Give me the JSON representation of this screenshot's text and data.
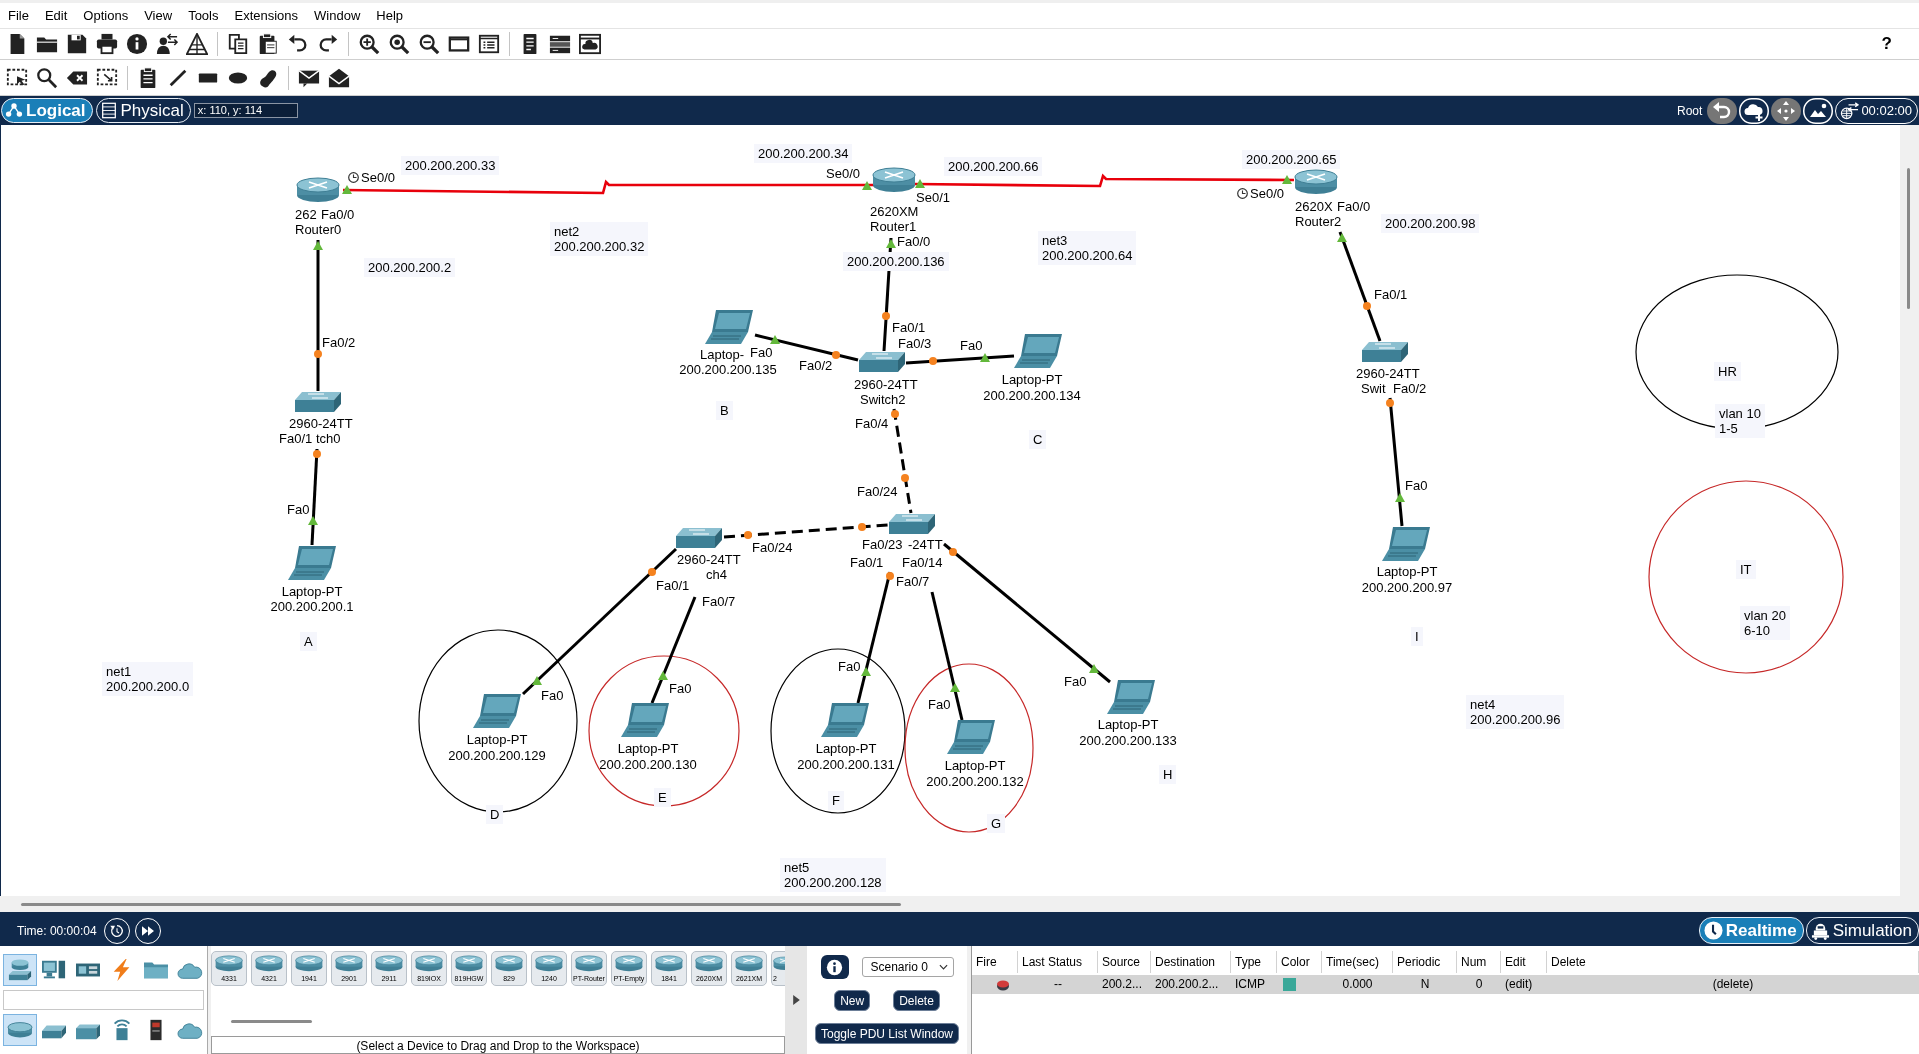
{
  "menu_bar": [
    "File",
    "Edit",
    "Options",
    "View",
    "Tools",
    "Extensions",
    "Window",
    "Help"
  ],
  "help_button": "?",
  "workspace_tabs": [
    {
      "label": "Logical",
      "selected": true
    },
    {
      "label": "Physical",
      "selected": false
    }
  ],
  "cursor_position": "x: 110, y: 114",
  "workspace_path": "Root",
  "clock": "00:02:00",
  "devices": [
    {
      "kind": "router",
      "model": "262",
      "name": "Router0"
    },
    {
      "kind": "router",
      "model": "2620XM",
      "name": "Router1"
    },
    {
      "kind": "router",
      "model": "2620X",
      "name": "Router2"
    },
    {
      "kind": "switch",
      "model": "2960-24TT",
      "name": "tch0"
    },
    {
      "kind": "switch",
      "model": "2960-24TT",
      "name": "Switch2"
    },
    {
      "kind": "switch",
      "model": "2960-24TT",
      "name": "Swit"
    },
    {
      "kind": "switch",
      "model": "2960-24TT",
      "name": "ch4"
    },
    {
      "kind": "switch",
      "model": "-24TT"
    },
    {
      "kind": "laptop",
      "model": "Laptop-PT",
      "name": "200.200.200.1"
    },
    {
      "kind": "laptop",
      "model": "Laptop-",
      "name": "200.200.200.135"
    },
    {
      "kind": "laptop",
      "model": "Laptop-PT",
      "name": "200.200.200.134"
    },
    {
      "kind": "laptop",
      "model": "Laptop-PT",
      "name": "200.200.200.129"
    },
    {
      "kind": "laptop",
      "model": "Laptop-PT",
      "name": "200.200.200.130"
    },
    {
      "kind": "laptop",
      "model": "Laptop-PT",
      "name": "200.200.200.131"
    },
    {
      "kind": "laptop",
      "model": "Laptop-PT",
      "name": "200.200.200.132"
    },
    {
      "kind": "laptop",
      "model": "Laptop-PT",
      "name": "200.200.200.133"
    },
    {
      "kind": "laptop",
      "model": "Laptop-PT",
      "name": "200.200.200.97"
    }
  ],
  "links": [
    {
      "kind": "serial",
      "ends": [
        {
          "port": "Se0/0",
          "forwarding": true,
          "clock": true
        },
        {
          "port": "Se0/0",
          "forwarding": true,
          "clock": false
        }
      ]
    },
    {
      "kind": "serial",
      "ends": [
        {
          "port": "Se0/1",
          "forwarding": true,
          "clock": false
        },
        {
          "port": "Se0/0",
          "forwarding": true,
          "clock": true
        }
      ]
    },
    {
      "kind": "straight",
      "ends": [
        {
          "port": "Fa0/0",
          "forwarding": true
        },
        {
          "port": "Fa0/2",
          "forwarding": false
        }
      ]
    },
    {
      "kind": "straight",
      "ends": [
        {
          "port": "Fa0/1",
          "forwarding": false
        },
        {
          "port": "Fa0",
          "forwarding": true
        }
      ]
    },
    {
      "kind": "straight",
      "ends": [
        {
          "port": "Fa0/0",
          "forwarding": true
        },
        {
          "port": "Fa0/1",
          "forwarding": false
        }
      ]
    },
    {
      "kind": "straight",
      "ends": [
        {
          "port": "Fa0",
          "forwarding": true
        },
        {
          "port": "Fa0/2",
          "forwarding": false
        }
      ]
    },
    {
      "kind": "straight",
      "ends": [
        {
          "port": "Fa0/3",
          "forwarding": false
        },
        {
          "port": "Fa0",
          "forwarding": true
        }
      ]
    },
    {
      "kind": "crossover",
      "ends": [
        {
          "port": "Fa0/4",
          "forwarding": false
        },
        {
          "port": "Fa0/24",
          "forwarding": false
        }
      ]
    },
    {
      "kind": "crossover",
      "ends": [
        {
          "port": "Fa0/24",
          "forwarding": false
        },
        {
          "port": "Fa0/23",
          "forwarding": false
        }
      ]
    },
    {
      "kind": "straight",
      "ends": [
        {
          "port": "Fa0/1",
          "forwarding": false
        },
        {
          "port": "Fa0",
          "forwarding": true
        }
      ]
    },
    {
      "kind": "straight",
      "ends": [
        {
          "port": "Fa0/7"
        },
        {
          "port": "Fa0",
          "forwarding": true
        }
      ]
    },
    {
      "kind": "straight",
      "ends": [
        {
          "port": "Fa0/1",
          "forwarding": false
        },
        {
          "port": "Fa0",
          "forwarding": true
        }
      ]
    },
    {
      "kind": "straight",
      "ends": [
        {
          "port": "Fa0/7"
        },
        {
          "port": "Fa0",
          "forwarding": true
        }
      ]
    },
    {
      "kind": "straight",
      "ends": [
        {
          "port": "Fa0/14",
          "forwarding": false
        },
        {
          "port": "Fa0",
          "forwarding": true
        }
      ]
    },
    {
      "kind": "straight",
      "ends": [
        {
          "port": "Fa0/0",
          "forwarding": true
        },
        {
          "port": "Fa0/1",
          "forwarding": false
        }
      ]
    },
    {
      "kind": "straight",
      "ends": [
        {
          "port": "Fa0/2",
          "forwarding": false
        },
        {
          "port": "Fa0",
          "forwarding": true
        }
      ]
    }
  ],
  "notes": [
    {
      "text": "200.200.200.33"
    },
    {
      "text": "200.200.200.34"
    },
    {
      "text": "200.200.200.66"
    },
    {
      "text": "200.200.200.65"
    },
    {
      "text": "net2\n200.200.200.32"
    },
    {
      "text": "200.200.200.2"
    },
    {
      "text": "200.200.200.136"
    },
    {
      "text": "net3\n200.200.200.64"
    },
    {
      "text": "200.200.200.98"
    },
    {
      "text": "HR"
    },
    {
      "text": "vlan 10\n1-5"
    },
    {
      "text": "B"
    },
    {
      "text": "C"
    },
    {
      "text": "A"
    },
    {
      "text": "net1\n200.200.200.0"
    },
    {
      "text": "IT"
    },
    {
      "text": "vlan 20\n6-10"
    },
    {
      "text": "D"
    },
    {
      "text": "E"
    },
    {
      "text": "F"
    },
    {
      "text": "G"
    },
    {
      "text": "H"
    },
    {
      "text": "I"
    },
    {
      "text": "net4\n200.200.200.96"
    },
    {
      "text": "net5\n200.200.200.128"
    }
  ],
  "shapes": [
    {
      "color": "#000000"
    },
    {
      "color": "#c62828"
    },
    {
      "color": "#000000"
    },
    {
      "color": "#c62828"
    },
    {
      "color": "#000000"
    },
    {
      "color": "#c62828"
    }
  ],
  "time_bar": {
    "time": "Time: 00:00:04",
    "modes": [
      {
        "label": "Realtime",
        "selected": true
      },
      {
        "label": "Simulation",
        "selected": false
      }
    ]
  },
  "device_categories": [
    {
      "selected": true
    },
    {
      "selected": false
    },
    {
      "selected": false
    },
    {
      "selected": false
    },
    {
      "selected": false
    },
    {
      "selected": false
    }
  ],
  "device_types": [
    {
      "selected": true
    },
    {
      "selected": false
    },
    {
      "selected": false
    },
    {
      "selected": false
    },
    {
      "selected": false
    },
    {
      "selected": false
    }
  ],
  "device_models": [
    "4331",
    "4321",
    "1941",
    "2901",
    "2911",
    "819IOX",
    "819HGW",
    "829",
    "1240",
    "PT-Router",
    "PT-Empty",
    "1841",
    "2620XM",
    "2621XM",
    "2"
  ],
  "device_hint": "(Select a Device to Drag and Drop to the Workspace)",
  "pdu_panel": {
    "scenario": "Scenario 0",
    "buttons": [
      "New",
      "Delete"
    ],
    "toggle_button": "Toggle PDU List Window"
  },
  "pdu_table": {
    "columns": [
      "Fire",
      "Last Status",
      "Source",
      "Destination",
      "Type",
      "Color",
      "Time(sec)",
      "Periodic",
      "Num",
      "Edit",
      "Delete"
    ],
    "rows": [
      {
        "last_status": "--",
        "source": "200.2...",
        "destination": "200.200.2...",
        "type": "ICMP",
        "color": "#3aa899",
        "time": "0.000",
        "periodic": "N",
        "num": "0",
        "edit": "(edit)",
        "delete": "(delete)"
      }
    ]
  }
}
